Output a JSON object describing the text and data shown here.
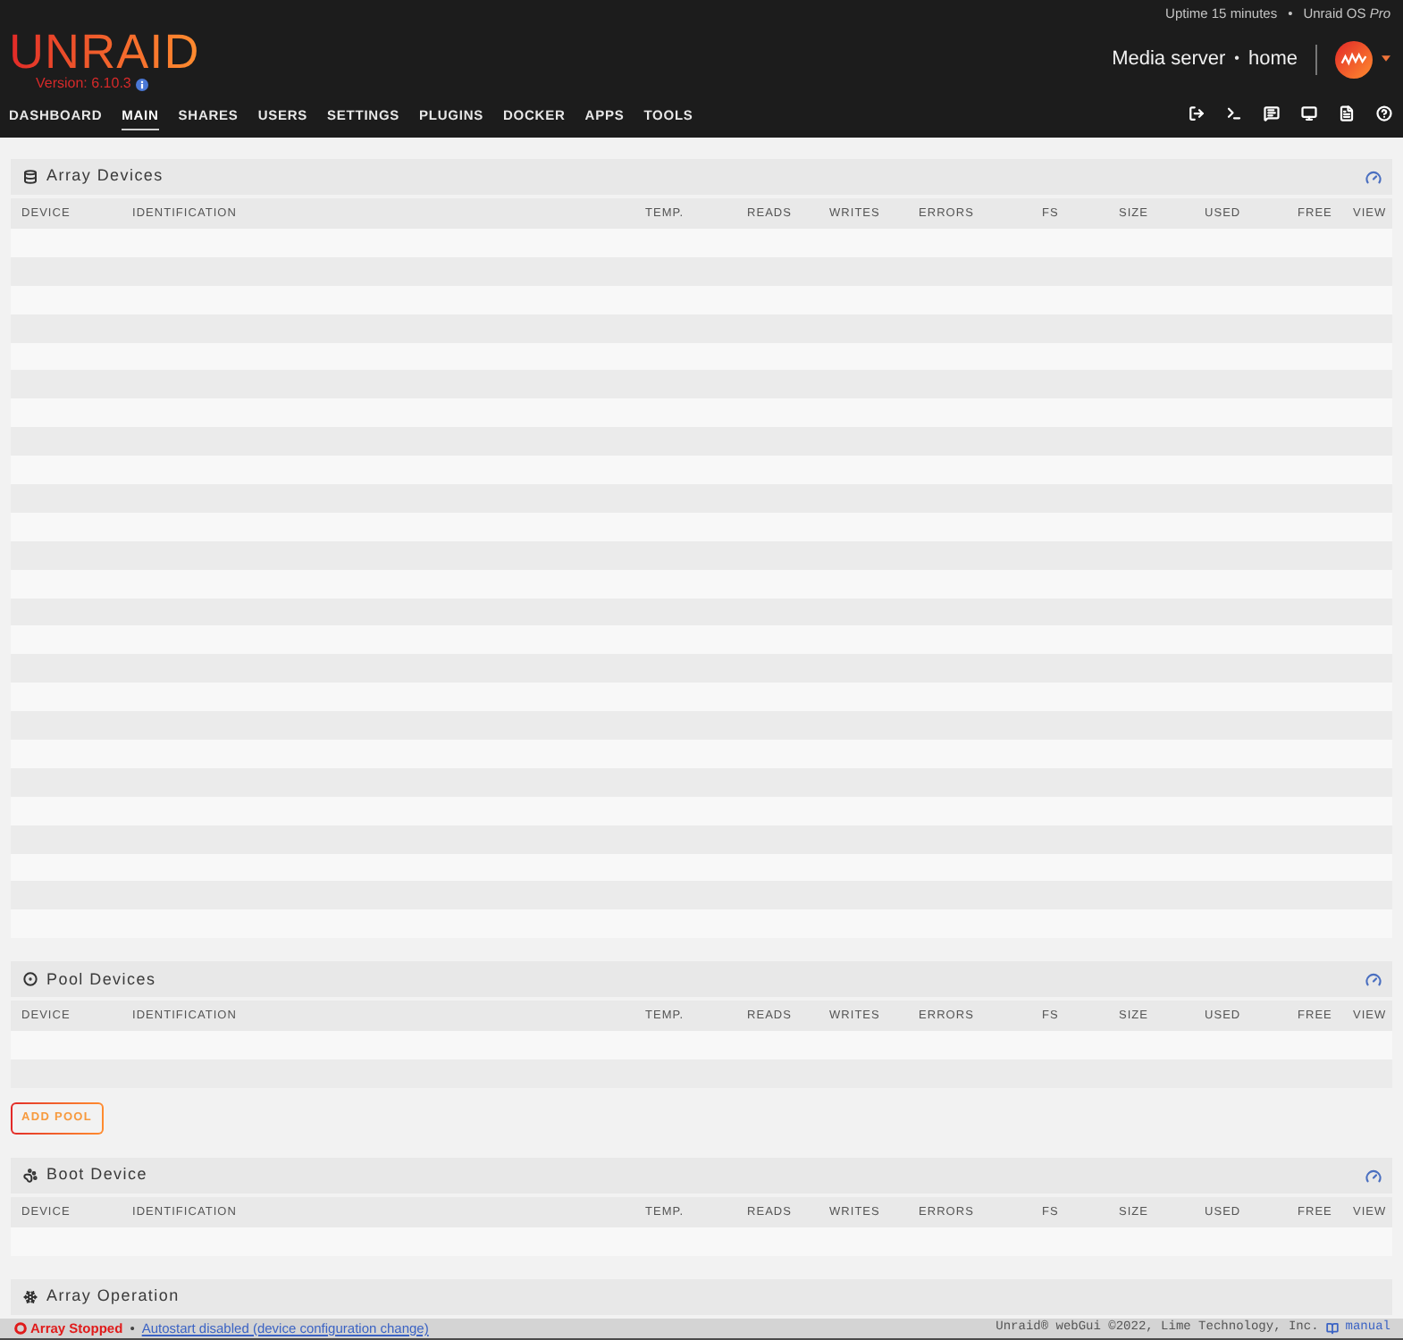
{
  "header": {
    "uptime": "Uptime 15 minutes",
    "uptime_separator": "•",
    "license": "Unraid OS *Pro*",
    "logo": "UNRAID",
    "version": "Version: 6.10.3",
    "server_name": "Media server",
    "server_separator": "•",
    "server_description": "home"
  },
  "nav": [
    {
      "label": "DASHBOARD",
      "selected": false
    },
    {
      "label": "MAIN",
      "selected": true
    },
    {
      "label": "SHARES",
      "selected": false
    },
    {
      "label": "USERS",
      "selected": false
    },
    {
      "label": "SETTINGS",
      "selected": false
    },
    {
      "label": "PLUGINS",
      "selected": false
    },
    {
      "label": "DOCKER",
      "selected": false
    },
    {
      "label": "APPS",
      "selected": false
    },
    {
      "label": "TOOLS",
      "selected": false
    }
  ],
  "sections": [
    {
      "kind": "array",
      "title": "Array Devices",
      "columns": [
        "DEVICE",
        "IDENTIFICATION",
        "TEMP.",
        "READS",
        "WRITES",
        "ERRORS",
        "FS",
        "SIZE",
        "USED",
        "FREE",
        "VIEW"
      ]
    },
    {
      "kind": "pool",
      "title": "Pool Devices",
      "columns": [
        "DEVICE",
        "IDENTIFICATION",
        "TEMP.",
        "READS",
        "WRITES",
        "ERRORS",
        "FS",
        "SIZE",
        "USED",
        "FREE",
        "VIEW"
      ],
      "button": "ADD POOL"
    },
    {
      "kind": "boot",
      "title": "Boot Device",
      "columns": [
        "DEVICE",
        "IDENTIFICATION",
        "TEMP.",
        "READS",
        "WRITES",
        "ERRORS",
        "FS",
        "SIZE",
        "USED",
        "FREE",
        "VIEW"
      ]
    },
    {
      "kind": "operation",
      "title": "Array Operation"
    }
  ],
  "status_bar": {
    "status": "Array Stopped",
    "separator": "•",
    "link": "Autostart disabled (device configuration change)",
    "copyright": "Unraid® webGui ©2022, Lime Technology, Inc.",
    "manual": "manual"
  }
}
